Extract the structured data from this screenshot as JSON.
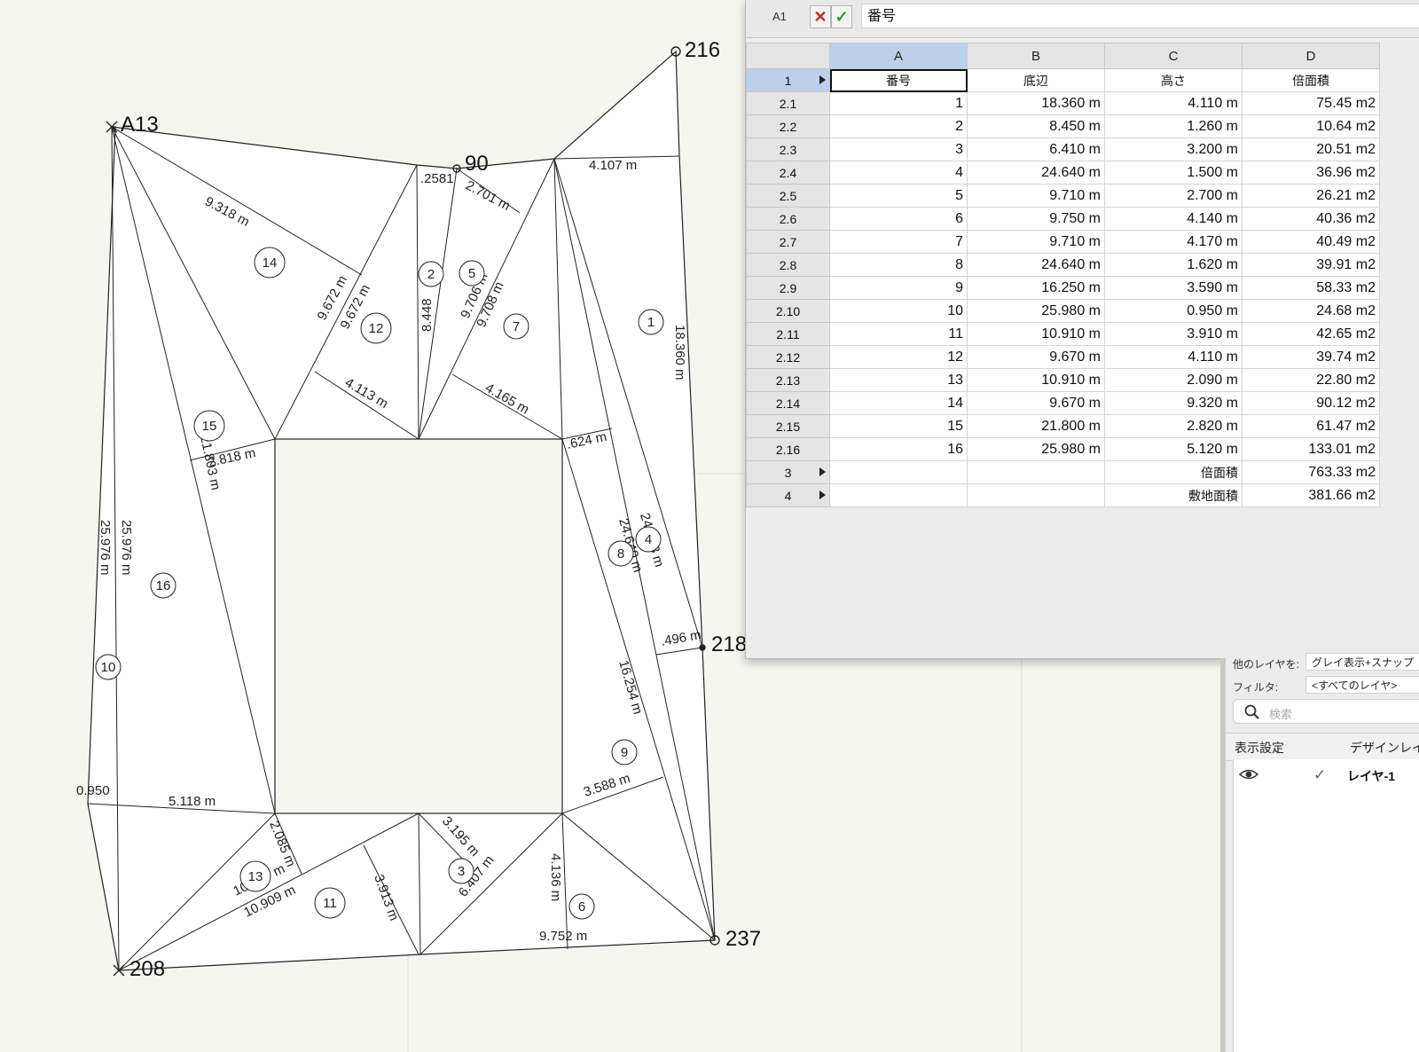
{
  "drawing": {
    "point_labels": [
      "216",
      "A13",
      "90",
      "218",
      "237",
      "208"
    ],
    "dimension_labels": [
      "9.318 m",
      "4.107 m",
      ".2581",
      "2.701 m",
      "9.672 m",
      "9.672 m",
      "8.448",
      "9.706 m",
      "9.708 m",
      "18.360 m",
      "4.113 m",
      "4.165 m",
      ".624 m",
      "2.818 m",
      "21.803 m",
      "25.976 m",
      "25.976 m",
      "24.640 m",
      "24.643 m",
      ".496 m",
      "16.254 m",
      "3.588 m",
      "0.950",
      "5.118 m",
      "2.085 m",
      "10.909 m",
      "10.909 m",
      "3.913 m",
      "3.195 m",
      "6.407 m",
      "4.136 m",
      "9.752 m"
    ],
    "triangle_numbers": [
      "1",
      "2",
      "3",
      "4",
      "5",
      "6",
      "7",
      "8",
      "9",
      "10",
      "11",
      "12",
      "13",
      "14",
      "15",
      "16"
    ]
  },
  "worksheet": {
    "cell_ref": "A1",
    "cancel_icon": "x-icon",
    "accept_icon": "checkmark-icon",
    "formula_value": "番号",
    "columns": [
      "A",
      "B",
      "C",
      "D"
    ],
    "header_row": {
      "id": "1",
      "cells": [
        "番号",
        "底辺",
        "高さ",
        "倍面積"
      ]
    },
    "rows": [
      {
        "id": "2.1",
        "cells": [
          "1",
          "18.360 m",
          "4.110 m",
          "75.45 m2"
        ]
      },
      {
        "id": "2.2",
        "cells": [
          "2",
          "8.450 m",
          "1.260 m",
          "10.64 m2"
        ]
      },
      {
        "id": "2.3",
        "cells": [
          "3",
          "6.410 m",
          "3.200 m",
          "20.51 m2"
        ]
      },
      {
        "id": "2.4",
        "cells": [
          "4",
          "24.640 m",
          "1.500 m",
          "36.96 m2"
        ]
      },
      {
        "id": "2.5",
        "cells": [
          "5",
          "9.710 m",
          "2.700 m",
          "26.21 m2"
        ]
      },
      {
        "id": "2.6",
        "cells": [
          "6",
          "9.750 m",
          "4.140 m",
          "40.36 m2"
        ]
      },
      {
        "id": "2.7",
        "cells": [
          "7",
          "9.710 m",
          "4.170 m",
          "40.49 m2"
        ]
      },
      {
        "id": "2.8",
        "cells": [
          "8",
          "24.640 m",
          "1.620 m",
          "39.91 m2"
        ]
      },
      {
        "id": "2.9",
        "cells": [
          "9",
          "16.250 m",
          "3.590 m",
          "58.33 m2"
        ]
      },
      {
        "id": "2.10",
        "cells": [
          "10",
          "25.980 m",
          "0.950 m",
          "24.68 m2"
        ]
      },
      {
        "id": "2.11",
        "cells": [
          "11",
          "10.910 m",
          "3.910 m",
          "42.65 m2"
        ]
      },
      {
        "id": "2.12",
        "cells": [
          "12",
          "9.670 m",
          "4.110 m",
          "39.74 m2"
        ]
      },
      {
        "id": "2.13",
        "cells": [
          "13",
          "10.910 m",
          "2.090 m",
          "22.80 m2"
        ]
      },
      {
        "id": "2.14",
        "cells": [
          "14",
          "9.670 m",
          "9.320 m",
          "90.12 m2"
        ]
      },
      {
        "id": "2.15",
        "cells": [
          "15",
          "21.800 m",
          "2.820 m",
          "61.47 m2"
        ]
      },
      {
        "id": "2.16",
        "cells": [
          "16",
          "25.980 m",
          "5.120 m",
          "133.01 m2"
        ]
      }
    ],
    "total_row": {
      "id": "3",
      "label": "倍面積",
      "value": "763.33 m2"
    },
    "site_row": {
      "id": "4",
      "label": "敷地面積",
      "value": "381.66 m2"
    }
  },
  "layers_palette": {
    "other_layers_label": "他のレイヤを:",
    "other_layers_value": "グレイ表示+スナップ",
    "filter_label": "フィルタ:",
    "filter_value": "<すべてのレイヤ>",
    "search_placeholder": "検索",
    "tab_display": "表示設定",
    "tab_design": "デザインレイヤ",
    "layer_name": "レイヤ-1",
    "layer_check": "✓"
  },
  "colors": {
    "canvas_bg": "#f6f6f1",
    "selected_header": "#bcd0ea",
    "cancel": "#c62a22",
    "accept": "#2e9a37"
  }
}
